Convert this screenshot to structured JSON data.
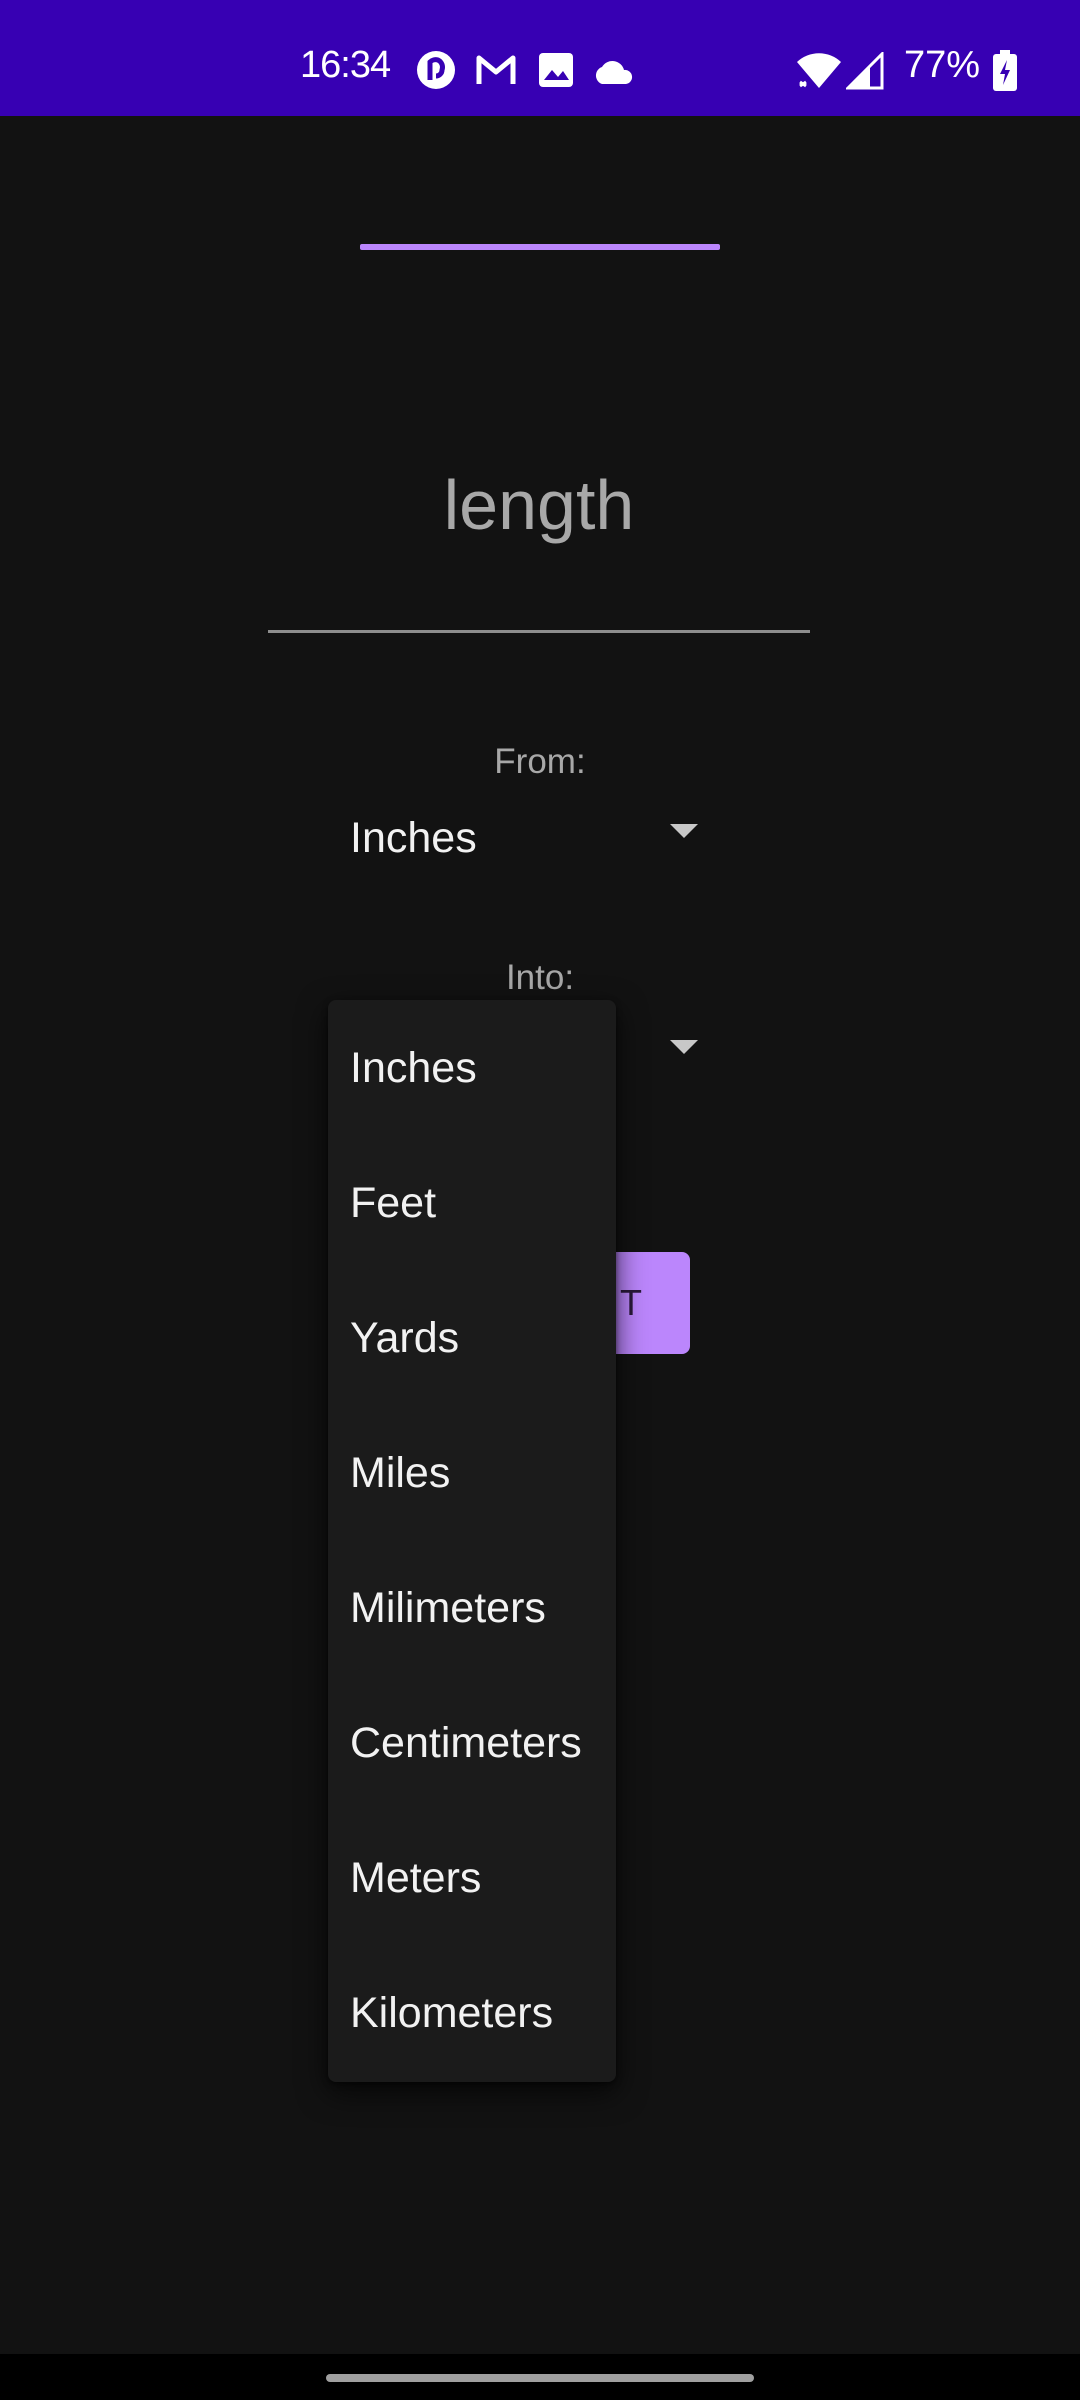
{
  "status_bar": {
    "time": "16:34",
    "notification_icons": [
      "pocket-casts-icon",
      "gmail-icon",
      "gallery-icon",
      "cloud-icon"
    ],
    "wifi_icon": "wifi-icon",
    "signal_icon": "signal-icon",
    "battery_percent": "77%",
    "battery_icon": "battery-charging-icon",
    "color": "#3700b3"
  },
  "converter": {
    "input_placeholder": "length",
    "from_label": "From:",
    "from_selected": "Inches",
    "into_label": "Into:",
    "convert_button_label": "T"
  },
  "dropdown": {
    "items": [
      "Inches",
      "Feet",
      "Yards",
      "Miles",
      "Milimeters",
      "Centimeters",
      "Meters",
      "Kilometers"
    ]
  },
  "colors": {
    "accent": "#bb86fc",
    "background": "#121212",
    "status_bar": "#3700b3"
  }
}
